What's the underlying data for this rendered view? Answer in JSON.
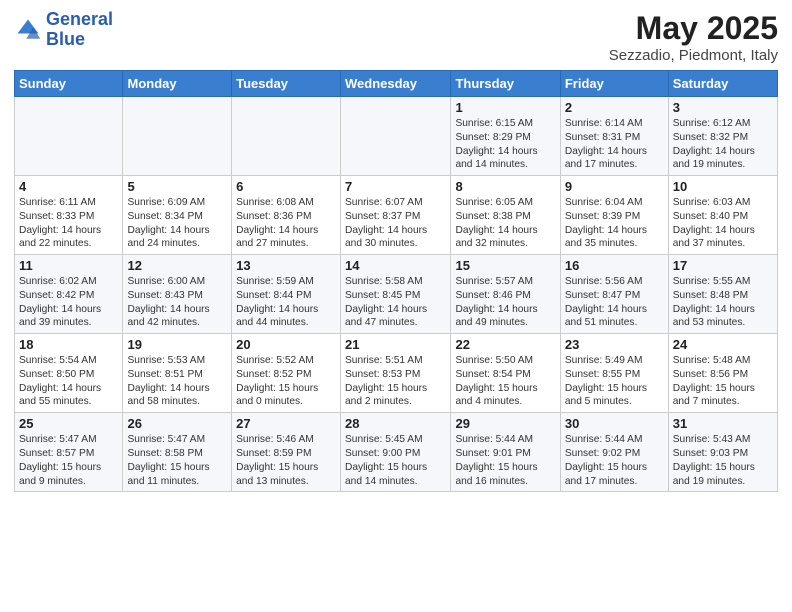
{
  "header": {
    "logo_line1": "General",
    "logo_line2": "Blue",
    "title": "May 2025",
    "subtitle": "Sezzadio, Piedmont, Italy"
  },
  "weekdays": [
    "Sunday",
    "Monday",
    "Tuesday",
    "Wednesday",
    "Thursday",
    "Friday",
    "Saturday"
  ],
  "weeks": [
    [
      {
        "day": "",
        "info": ""
      },
      {
        "day": "",
        "info": ""
      },
      {
        "day": "",
        "info": ""
      },
      {
        "day": "",
        "info": ""
      },
      {
        "day": "1",
        "info": "Sunrise: 6:15 AM\nSunset: 8:29 PM\nDaylight: 14 hours and 14 minutes."
      },
      {
        "day": "2",
        "info": "Sunrise: 6:14 AM\nSunset: 8:31 PM\nDaylight: 14 hours and 17 minutes."
      },
      {
        "day": "3",
        "info": "Sunrise: 6:12 AM\nSunset: 8:32 PM\nDaylight: 14 hours and 19 minutes."
      }
    ],
    [
      {
        "day": "4",
        "info": "Sunrise: 6:11 AM\nSunset: 8:33 PM\nDaylight: 14 hours and 22 minutes."
      },
      {
        "day": "5",
        "info": "Sunrise: 6:09 AM\nSunset: 8:34 PM\nDaylight: 14 hours and 24 minutes."
      },
      {
        "day": "6",
        "info": "Sunrise: 6:08 AM\nSunset: 8:36 PM\nDaylight: 14 hours and 27 minutes."
      },
      {
        "day": "7",
        "info": "Sunrise: 6:07 AM\nSunset: 8:37 PM\nDaylight: 14 hours and 30 minutes."
      },
      {
        "day": "8",
        "info": "Sunrise: 6:05 AM\nSunset: 8:38 PM\nDaylight: 14 hours and 32 minutes."
      },
      {
        "day": "9",
        "info": "Sunrise: 6:04 AM\nSunset: 8:39 PM\nDaylight: 14 hours and 35 minutes."
      },
      {
        "day": "10",
        "info": "Sunrise: 6:03 AM\nSunset: 8:40 PM\nDaylight: 14 hours and 37 minutes."
      }
    ],
    [
      {
        "day": "11",
        "info": "Sunrise: 6:02 AM\nSunset: 8:42 PM\nDaylight: 14 hours and 39 minutes."
      },
      {
        "day": "12",
        "info": "Sunrise: 6:00 AM\nSunset: 8:43 PM\nDaylight: 14 hours and 42 minutes."
      },
      {
        "day": "13",
        "info": "Sunrise: 5:59 AM\nSunset: 8:44 PM\nDaylight: 14 hours and 44 minutes."
      },
      {
        "day": "14",
        "info": "Sunrise: 5:58 AM\nSunset: 8:45 PM\nDaylight: 14 hours and 47 minutes."
      },
      {
        "day": "15",
        "info": "Sunrise: 5:57 AM\nSunset: 8:46 PM\nDaylight: 14 hours and 49 minutes."
      },
      {
        "day": "16",
        "info": "Sunrise: 5:56 AM\nSunset: 8:47 PM\nDaylight: 14 hours and 51 minutes."
      },
      {
        "day": "17",
        "info": "Sunrise: 5:55 AM\nSunset: 8:48 PM\nDaylight: 14 hours and 53 minutes."
      }
    ],
    [
      {
        "day": "18",
        "info": "Sunrise: 5:54 AM\nSunset: 8:50 PM\nDaylight: 14 hours and 55 minutes."
      },
      {
        "day": "19",
        "info": "Sunrise: 5:53 AM\nSunset: 8:51 PM\nDaylight: 14 hours and 58 minutes."
      },
      {
        "day": "20",
        "info": "Sunrise: 5:52 AM\nSunset: 8:52 PM\nDaylight: 15 hours and 0 minutes."
      },
      {
        "day": "21",
        "info": "Sunrise: 5:51 AM\nSunset: 8:53 PM\nDaylight: 15 hours and 2 minutes."
      },
      {
        "day": "22",
        "info": "Sunrise: 5:50 AM\nSunset: 8:54 PM\nDaylight: 15 hours and 4 minutes."
      },
      {
        "day": "23",
        "info": "Sunrise: 5:49 AM\nSunset: 8:55 PM\nDaylight: 15 hours and 5 minutes."
      },
      {
        "day": "24",
        "info": "Sunrise: 5:48 AM\nSunset: 8:56 PM\nDaylight: 15 hours and 7 minutes."
      }
    ],
    [
      {
        "day": "25",
        "info": "Sunrise: 5:47 AM\nSunset: 8:57 PM\nDaylight: 15 hours and 9 minutes."
      },
      {
        "day": "26",
        "info": "Sunrise: 5:47 AM\nSunset: 8:58 PM\nDaylight: 15 hours and 11 minutes."
      },
      {
        "day": "27",
        "info": "Sunrise: 5:46 AM\nSunset: 8:59 PM\nDaylight: 15 hours and 13 minutes."
      },
      {
        "day": "28",
        "info": "Sunrise: 5:45 AM\nSunset: 9:00 PM\nDaylight: 15 hours and 14 minutes."
      },
      {
        "day": "29",
        "info": "Sunrise: 5:44 AM\nSunset: 9:01 PM\nDaylight: 15 hours and 16 minutes."
      },
      {
        "day": "30",
        "info": "Sunrise: 5:44 AM\nSunset: 9:02 PM\nDaylight: 15 hours and 17 minutes."
      },
      {
        "day": "31",
        "info": "Sunrise: 5:43 AM\nSunset: 9:03 PM\nDaylight: 15 hours and 19 minutes."
      }
    ]
  ]
}
